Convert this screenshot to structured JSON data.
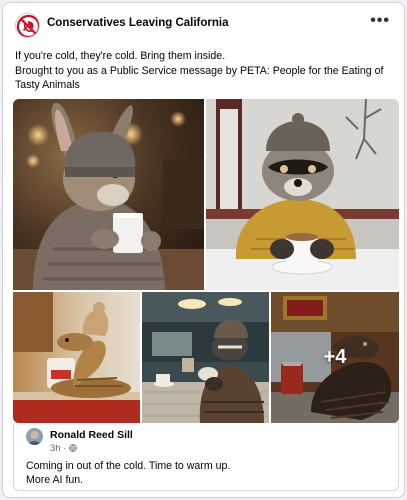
{
  "post": {
    "group_name": "Conservatives Leaving California",
    "more_label": "•••",
    "text_lines": [
      "If you're cold, they're cold. Bring them inside.",
      "Brought to you as a Public Service message by PETA: People for the Eating of",
      "Tasty Animals"
    ],
    "more_photos_label": "+4"
  },
  "comment": {
    "author": "Ronald Reed Sill",
    "time": "3h · ",
    "text_lines": [
      "Coming in out of the cold.  Time to warm up.",
      "More AI fun."
    ]
  },
  "colors": {
    "link_text": "#050505",
    "meta_text": "#65676b",
    "logo_red": "#c8102e"
  },
  "icons": {
    "avatar": "no-communism-icon",
    "privacy": "globe-icon",
    "menu": "more-icon"
  }
}
